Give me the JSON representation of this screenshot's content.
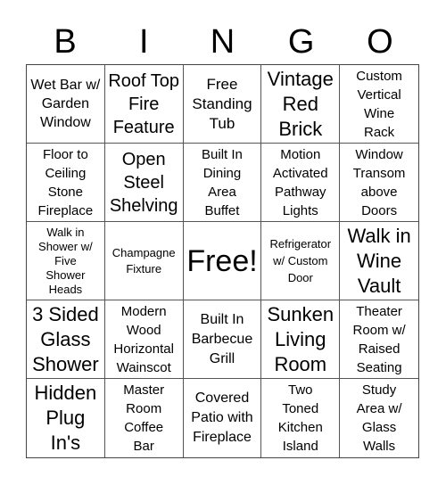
{
  "header": {
    "letters": [
      "B",
      "I",
      "N",
      "G",
      "O"
    ]
  },
  "cells": [
    "Wet Bar w/ Garden Window",
    "Roof Top Fire Feature",
    "Free Standing Tub",
    "Vintage Red Brick",
    "Custom Vertical Wine Rack",
    "Floor to Ceiling Stone Fireplace",
    "Open Steel Shelving",
    "Built In Dining Area Buffet",
    "Motion Activated Pathway Lights",
    "Window Transom above Doors",
    "Walk in Shower w/ Five Shower Heads",
    "Champagne Fixture",
    "Free!",
    "Refrigerator w/ Custom Door",
    "Walk in Wine Vault",
    "3 Sided Glass Shower",
    "Modern Wood Horizontal Wainscot",
    "Built In Barbecue Grill",
    "Sunken Living Room",
    "Theater Room w/ Raised Seating",
    "Hidden Plug In's",
    "Master Room Coffee Bar",
    "Covered Patio with Fireplace",
    "Two Toned Kitchen Island",
    "Study Area w/ Glass Walls"
  ]
}
